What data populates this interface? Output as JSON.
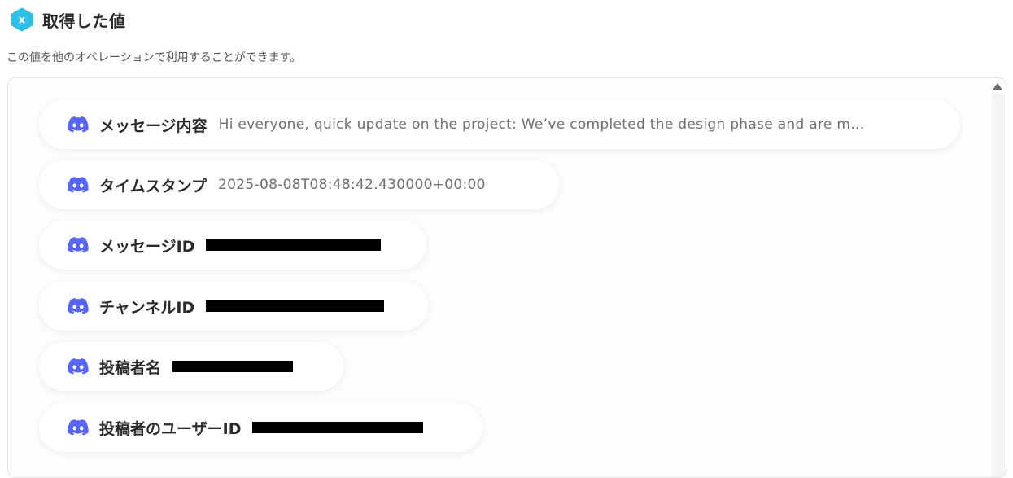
{
  "header": {
    "title": "取得した値",
    "badge_icon": "x-variable-icon",
    "badge_color": "#2cc0e8"
  },
  "subtitle": "この値を他のオペレーションで利用することができます。",
  "items": [
    {
      "icon": "discord-icon",
      "label": "メッセージ内容",
      "value": "Hi everyone, quick update on the project: We’ve completed the design phase and are m…"
    },
    {
      "icon": "discord-icon",
      "label": "タイムスタンプ",
      "value": "2025-08-08T08:48:42.430000+00:00"
    },
    {
      "icon": "discord-icon",
      "label": "メッセージID",
      "value": "",
      "redacted": true
    },
    {
      "icon": "discord-icon",
      "label": "チャンネルID",
      "value": "",
      "redacted": true
    },
    {
      "icon": "discord-icon",
      "label": "投稿者名",
      "value": "",
      "redacted": true
    },
    {
      "icon": "discord-icon",
      "label": "投稿者のユーザーID",
      "value": "",
      "redacted": true
    }
  ],
  "colors": {
    "discord": "#5865f2",
    "badge": "#2cc0e8"
  }
}
